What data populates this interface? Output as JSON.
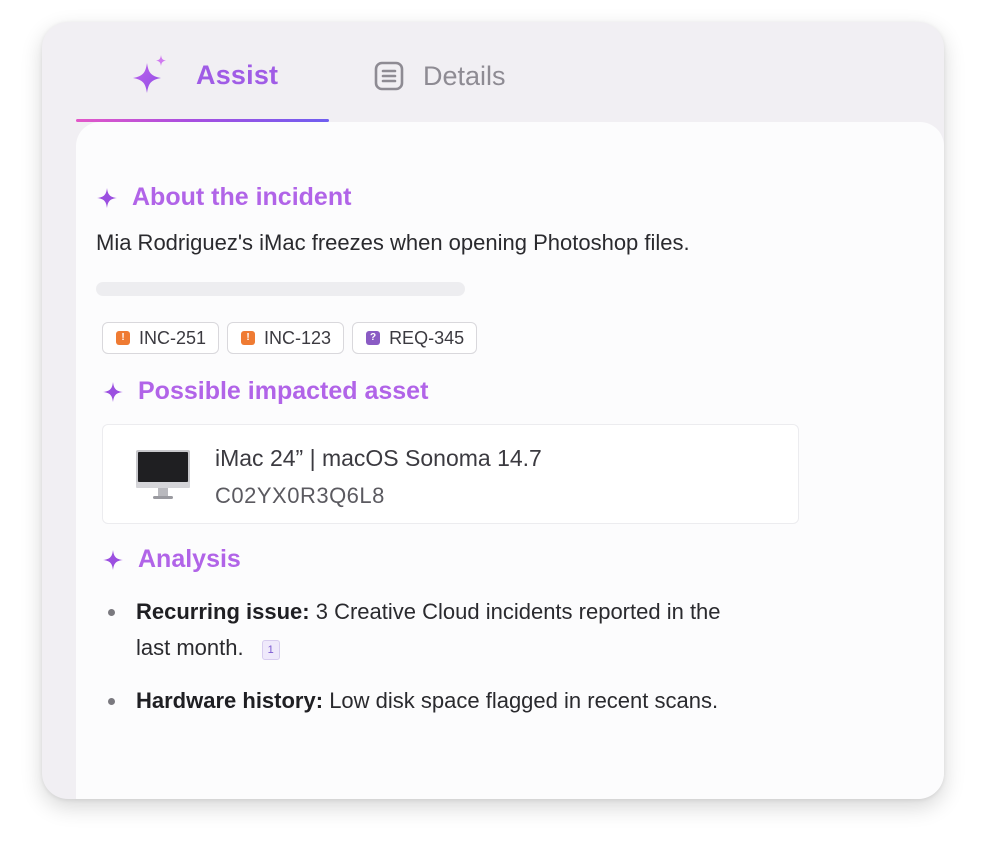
{
  "tabs": {
    "assist": {
      "label": "Assist",
      "icon": "sparkle-icon",
      "active": true
    },
    "details": {
      "label": "Details",
      "icon": "list-document-icon",
      "active": false
    }
  },
  "colors": {
    "accent": "#b164e8",
    "tab_active": "#a05ce6",
    "tab_inactive": "#8e8b93",
    "incident_badge": "#ef7b33",
    "request_badge": "#8a5bc4"
  },
  "incident": {
    "title": "About the incident",
    "summary": "Mia Rodriguez's iMac freezes when opening Photoshop files.",
    "tickets": [
      {
        "id": "INC-251",
        "icon": "!",
        "kind": "incident"
      },
      {
        "id": "INC-123",
        "icon": "!",
        "kind": "incident"
      },
      {
        "id": "REQ-345",
        "icon": "?",
        "kind": "request"
      }
    ]
  },
  "asset": {
    "title": "Possible impacted asset",
    "name": "iMac 24” | macOS Sonoma 14.7",
    "serial": "C02YX0R3Q6L8",
    "icon": "imac-icon"
  },
  "analysis": {
    "title": "Analysis",
    "items": [
      {
        "label": "Recurring issue:",
        "text": "3 Creative Cloud incidents reported in the last month.",
        "citation": "1"
      },
      {
        "label": "Hardware history:",
        "text": "Low disk space flagged in recent scans."
      }
    ]
  }
}
